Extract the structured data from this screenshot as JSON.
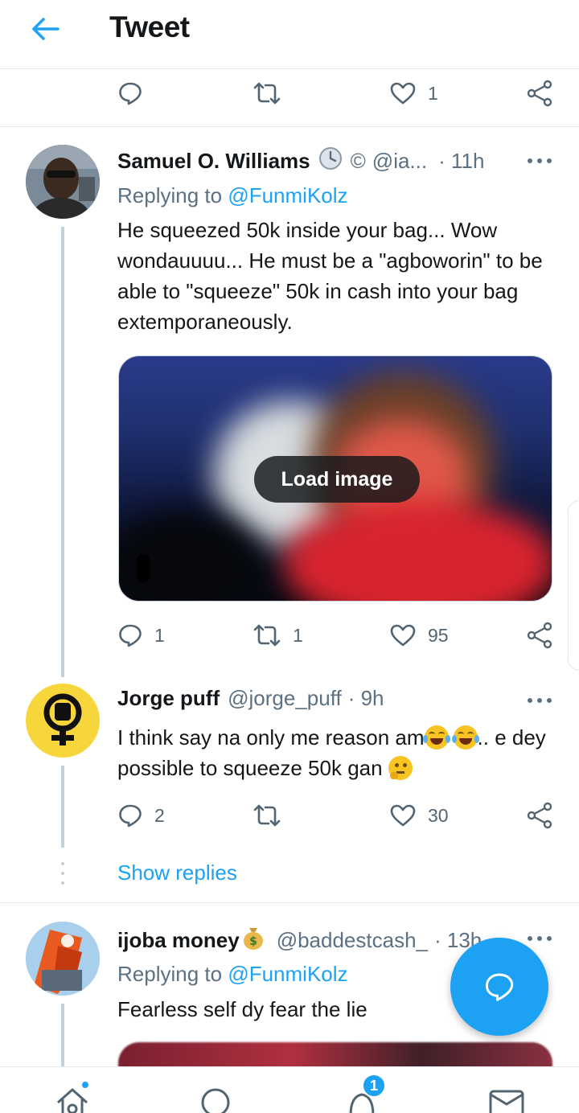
{
  "header": {
    "title": "Tweet"
  },
  "top_actions": {
    "like_count": "1"
  },
  "tweets": [
    {
      "name": "Samuel O. Williams",
      "extra_glyph": "©",
      "handle": "@ia...",
      "time": "· 11h",
      "replying_label": "Replying to",
      "replying_handle": "@FunmiKolz",
      "text": "He squeezed 50k inside your bag... Wow wondauuuu... He must be a \"agboworin\" to be able to \"squeeze\" 50k in cash into your bag extemporaneously.",
      "media_button": "Load image",
      "reply_count": "1",
      "retweet_count": "1",
      "like_count": "95"
    },
    {
      "name": "Jorge puff",
      "handle": "@jorge_puff",
      "time": "· 9h",
      "text_part1": "I think say na only me reason am",
      "text_part2": ".. e dey possible to squeeze 50k gan ",
      "reply_count": "2",
      "retweet_count": "",
      "like_count": "30",
      "show_replies": "Show replies"
    },
    {
      "name": "ijoba money",
      "handle": "@baddestcash_",
      "time": "· 13h",
      "replying_label": "Replying to",
      "replying_handle": "@FunmiKolz",
      "text": "Fearless self dy fear the lie"
    }
  ],
  "bottom_nav": {
    "notifications_badge": "1"
  },
  "colors": {
    "accent": "#1da1f2",
    "text": "#14171a",
    "muted": "#5b7083",
    "divider": "#e1e8ed"
  }
}
